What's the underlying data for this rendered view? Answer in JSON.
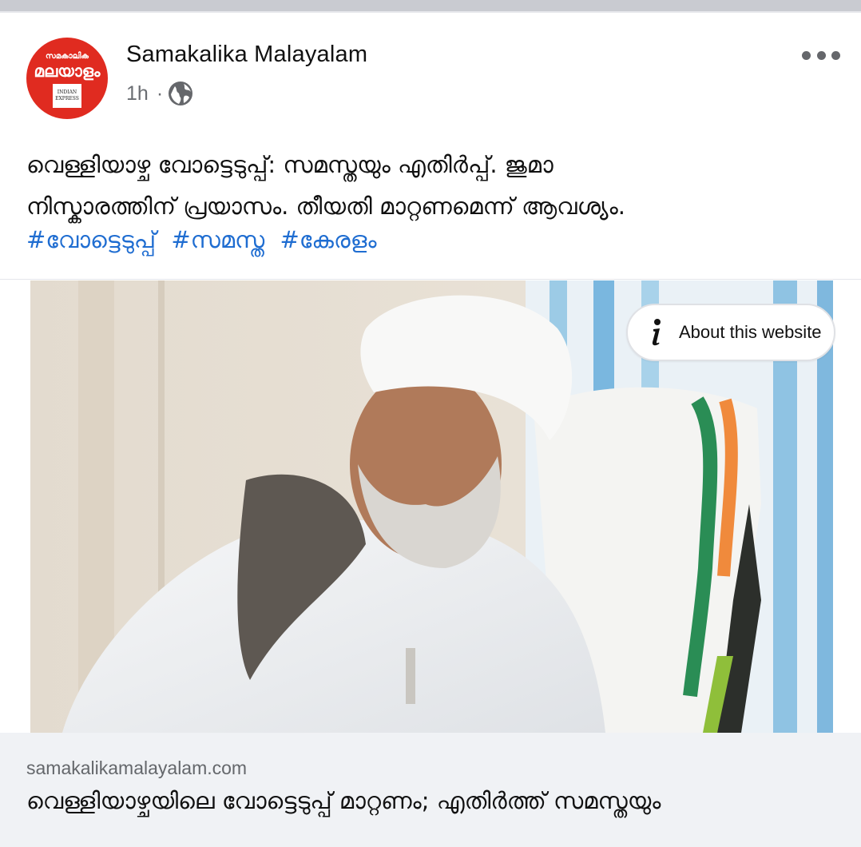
{
  "post": {
    "page_name": "Samakalika Malayalam",
    "time": "1h",
    "separator": "·",
    "audience_icon": "globe-icon",
    "more_icon": "more-horizontal-icon",
    "avatar": {
      "logo_top": "സമകാലിക",
      "logo_main": "മലയാളം",
      "logo_box": [
        "INDIAN",
        "EXPRESS"
      ]
    },
    "text_line1": "വെള്ളിയാഴ്ച വോട്ടെടുപ്പ്: സമസ്തയും എതിർപ്പ്. ജുമാ",
    "text_line2": "നിസ്കാരത്തിന് പ്രയാസം. തീയതി മാറ്റണമെന്ന് ആവശ്യം.",
    "hashtags": [
      "#വോട്ടെടുപ്പ്",
      "#സമസ്ത",
      "#കേരളം"
    ]
  },
  "link_preview": {
    "about_label": "About this website",
    "about_icon": "info-icon",
    "domain": "samakalikamalayalam.com",
    "title": "വെള്ളിയാഴ്ചയിലെ വോട്ടെടുപ്പ് മാറ്റണം; എതിർത്ത് സമസ്തയും"
  },
  "colors": {
    "hashtag": "#1f6dd1",
    "avatar_red": "#e02b20",
    "footer_bg": "#f0f2f5"
  }
}
